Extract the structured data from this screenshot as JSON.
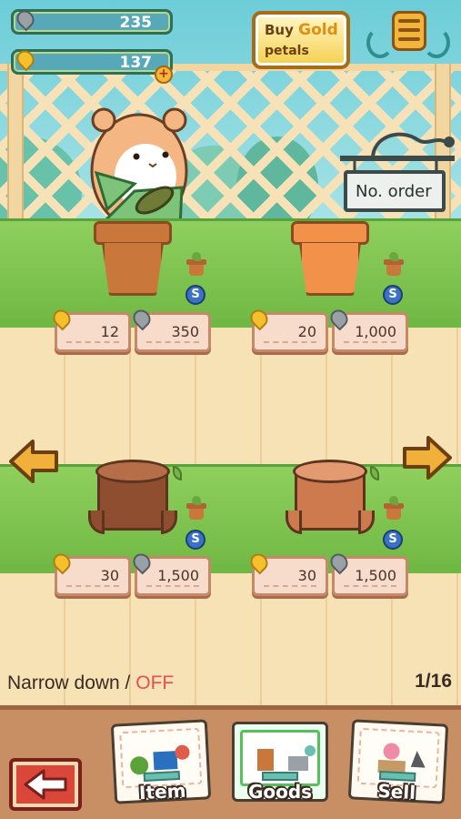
{
  "header": {
    "silver_petals": "235",
    "gold_petals": "137",
    "buy_gold": {
      "line1_a": "Buy",
      "line1_b": "Gold",
      "line2": "petals"
    },
    "plus_symbol": "+"
  },
  "sign": {
    "label": "No. order"
  },
  "items": [
    {
      "kind": "pot-dark",
      "gold_price": "12",
      "silver_price": "350",
      "size_badge": "S"
    },
    {
      "kind": "pot-light",
      "gold_price": "20",
      "silver_price": "1,000",
      "size_badge": "S"
    },
    {
      "kind": "stump-dark",
      "gold_price": "30",
      "silver_price": "1,500",
      "size_badge": "S"
    },
    {
      "kind": "stump-light",
      "gold_price": "30",
      "silver_price": "1,500",
      "size_badge": "S"
    }
  ],
  "filter": {
    "label": "Narrow down /",
    "state": "OFF"
  },
  "pagination": {
    "label": "1/16"
  },
  "bottom_nav": [
    {
      "label": "Item"
    },
    {
      "label": "Goods"
    },
    {
      "label": "Sell"
    }
  ],
  "colors": {
    "gold": "#f4c02b",
    "silver": "#9aa1a6",
    "grass": "#8fcf5d",
    "off_red": "#e35050"
  },
  "icons": [
    "silver-petal-icon",
    "gold-petal-icon",
    "menu-icon",
    "left-arrow-icon",
    "right-arrow-icon",
    "back-arrow-icon"
  ]
}
